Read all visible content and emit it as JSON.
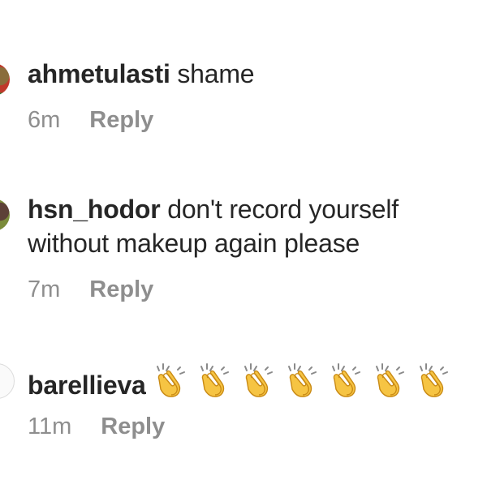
{
  "comments": [
    {
      "username": "ahmetulasti",
      "text": "shame",
      "time": "6m",
      "reply_label": "Reply"
    },
    {
      "username": "hsn_hodor",
      "text": "don't record yourself without makeup again please",
      "time": "7m",
      "reply_label": "Reply"
    },
    {
      "username": "barellieva",
      "text": "",
      "emoji": "clapping-hands-icon",
      "emoji_count": 7,
      "time": "11m",
      "reply_label": "Reply"
    }
  ],
  "colors": {
    "text": "#262626",
    "meta": "#8e8e8e",
    "clap_fill": "#f6c443"
  }
}
